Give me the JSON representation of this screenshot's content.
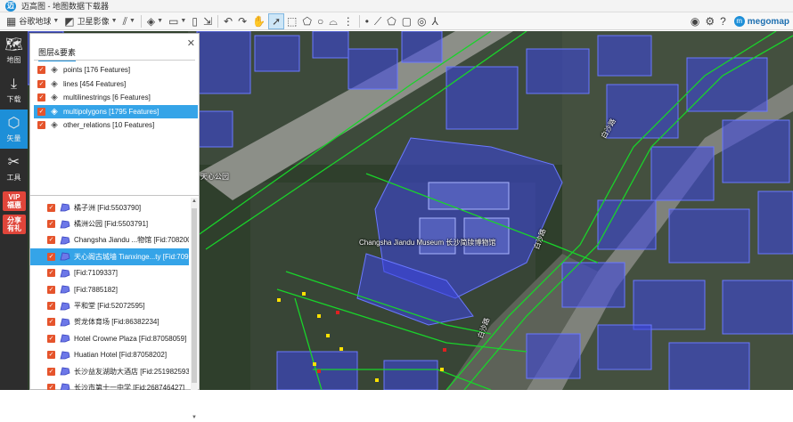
{
  "window": {
    "title": "迈高图 - 地图数据下载器"
  },
  "toolbar": {
    "basemap_label": "谷歌地球",
    "imagery_label": "卫星影像"
  },
  "brand": {
    "name": "megomap"
  },
  "sidebar": {
    "items": [
      {
        "icon": "map-icon",
        "label": "地图"
      },
      {
        "icon": "download-icon",
        "label": "下载"
      },
      {
        "icon": "vector-icon",
        "label": "矢量"
      },
      {
        "icon": "tools-icon",
        "label": "工具"
      }
    ],
    "badges": [
      {
        "line1": "VIP",
        "line2": "福惠"
      },
      {
        "line1": "分享",
        "line2": "有礼"
      }
    ]
  },
  "panel": {
    "tab_label": "图层&要素",
    "close_label": "✕",
    "layers": [
      {
        "label": "points [176 Features]",
        "selected": false
      },
      {
        "label": "lines [454 Features]",
        "selected": false
      },
      {
        "label": "multilinestrings [6 Features]",
        "selected": false
      },
      {
        "label": "multipolygons [1795 Features]",
        "selected": true
      },
      {
        "label": "other_relations [10 Features]",
        "selected": false
      }
    ],
    "features": [
      {
        "label": "橘子洲 [Fid:5503790]",
        "selected": false
      },
      {
        "label": "橘洲公园 [Fid:5503791]",
        "selected": false
      },
      {
        "label": "Changsha Jiandu ...物馆 [Fid:7082008]",
        "selected": false
      },
      {
        "label": "天心阁古城墙 Tianxinge...ty [Fid:7096204]",
        "selected": true
      },
      {
        "label": "[Fid:7109337]",
        "selected": false
      },
      {
        "label": "[Fid:7885182]",
        "selected": false
      },
      {
        "label": "平和堂 [Fid:52072595]",
        "selected": false
      },
      {
        "label": "贺龙体育场 [Fid:86382234]",
        "selected": false
      },
      {
        "label": "Hotel Crowne Plaza [Fid:87058059]",
        "selected": false
      },
      {
        "label": "Huatian Hotel [Fid:87058202]",
        "selected": false
      },
      {
        "label": "长沙益友湖助大酒店 [Fid:251982593]",
        "selected": false
      },
      {
        "label": "长沙市第十一中学 [Fid:268746427]",
        "selected": false
      }
    ]
  },
  "map": {
    "labels": [
      {
        "text": "天心公园"
      },
      {
        "text": "Changsha Jiandu Museum 长沙简牍博物馆"
      },
      {
        "text": "白沙路"
      },
      {
        "text": "白沙路"
      },
      {
        "text": "白沙路"
      }
    ],
    "colors": {
      "polygon_fill": "#3c46e6",
      "road_line": "#19d42a",
      "accent": "#1d8fd8"
    }
  }
}
